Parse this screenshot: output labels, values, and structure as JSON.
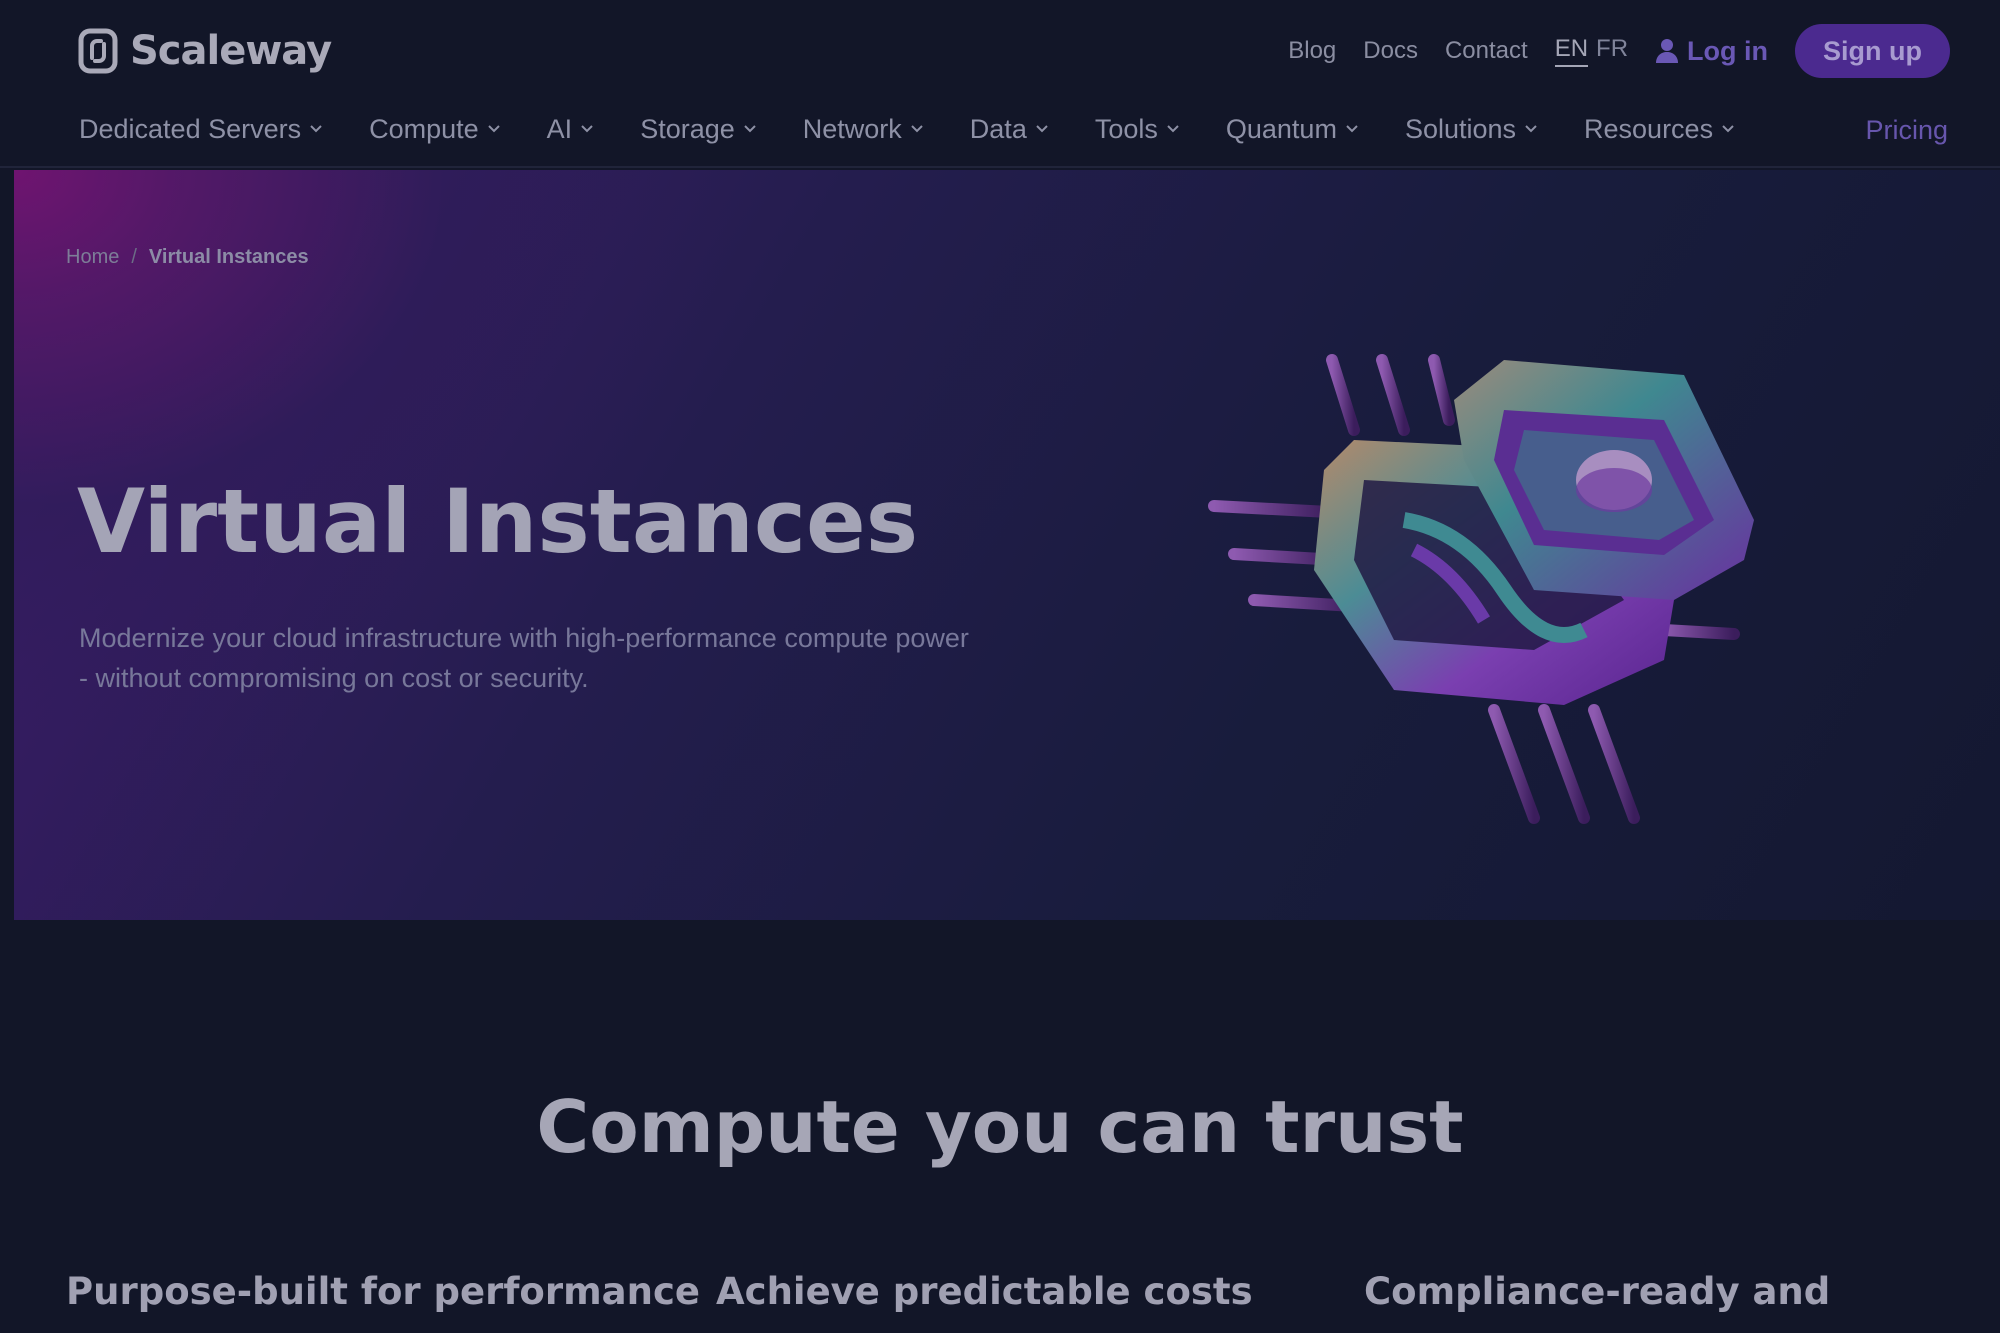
{
  "brand": {
    "name": "Scaleway"
  },
  "utility_nav": {
    "links": [
      "Blog",
      "Docs",
      "Contact"
    ],
    "lang_active": "EN",
    "lang_other": "FR",
    "login_label": "Log in",
    "signup_label": "Sign up"
  },
  "main_nav": {
    "items": [
      "Dedicated Servers",
      "Compute",
      "AI",
      "Storage",
      "Network",
      "Data",
      "Tools",
      "Quantum",
      "Solutions",
      "Resources"
    ],
    "pricing_label": "Pricing"
  },
  "breadcrumb": {
    "home": "Home",
    "separator": "/",
    "current": "Virtual Instances"
  },
  "hero": {
    "title": "Virtual Instances",
    "description": "Modernize your cloud infrastructure with high-performance compute power - without compromising on cost or security."
  },
  "section": {
    "title": "Compute you can trust",
    "features": [
      "Purpose-built for performance",
      "Achieve predictable costs",
      "Compliance-ready and"
    ]
  },
  "colors": {
    "background": "#121628",
    "accent": "#4b2a8f",
    "accent_text": "#6756ad",
    "hero_gradient_start": "#6f1470"
  },
  "icons": {
    "logo": "scaleway-logo-icon",
    "user": "user-icon",
    "chevron": "chevron-down-icon",
    "illustration": "cpu-chip-illustration"
  }
}
